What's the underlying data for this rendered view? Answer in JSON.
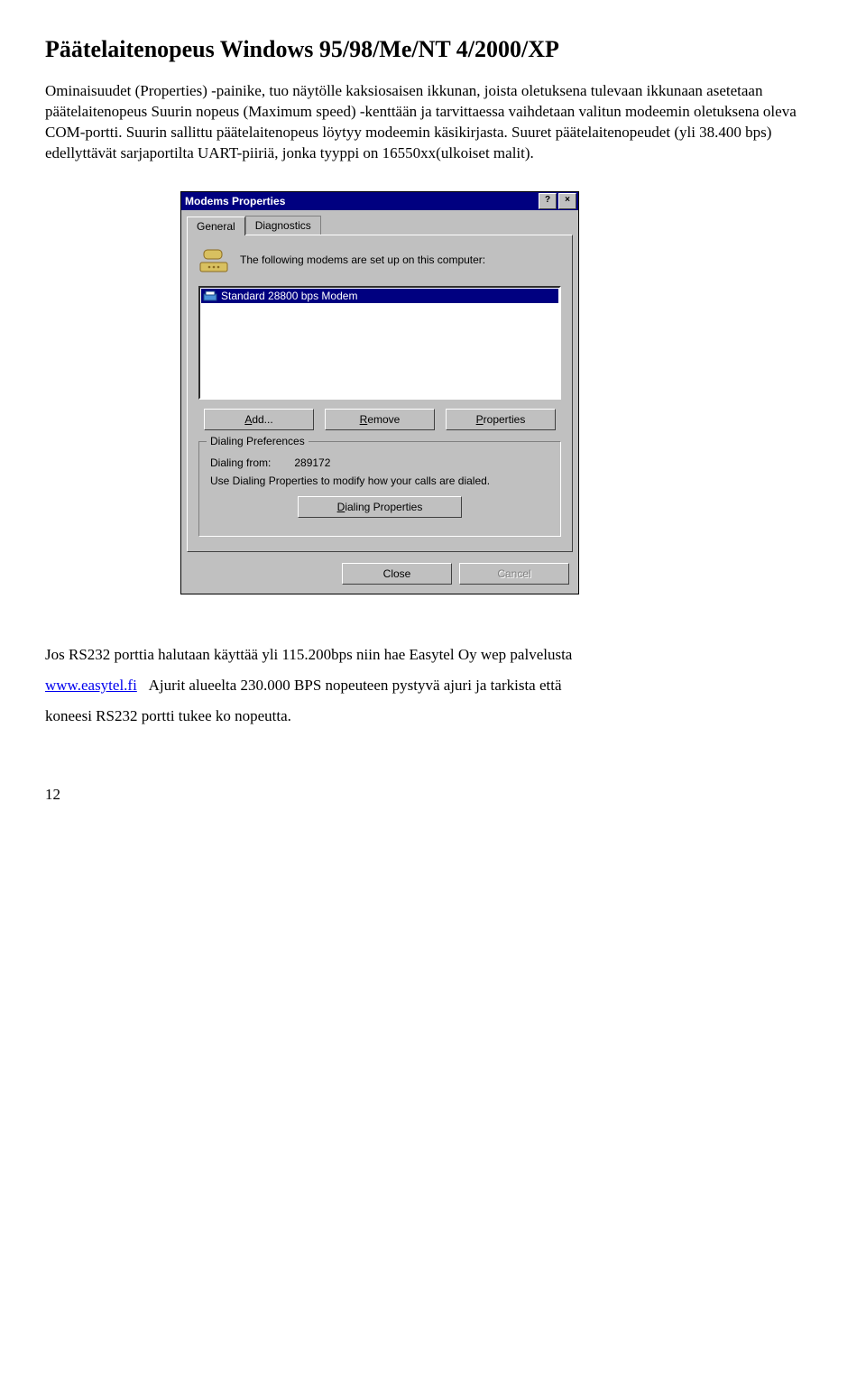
{
  "heading": "Päätelaitenopeus Windows 95/98/Me/NT 4/2000/XP",
  "para1": "Ominaisuudet (Properties) -painike, tuo näytölle kaksiosaisen ikkunan, joista oletuksena tulevaan ikkunaan asetetaan päätelaitenopeus Suurin nopeus (Maximum speed) -kenttään ja tarvittaessa vaihdetaan valitun modeemin oletuksena oleva COM-portti. Suurin sallittu päätelaitenopeus löytyy modeemin käsikirjasta. Suuret päätelaitenopeudet (yli 38.400 bps) edellyttävät sarjaportilta UART-piiriä, jonka tyyppi on 16550xx(ulkoiset malit).",
  "para2_prefix": "Jos RS232 porttia halutaan käyttää yli 115.200bps  niin hae Easytel Oy wep palvelusta",
  "link_text": "www.easytel.fi",
  "para2_suffix": "Ajurit alueelta  230.000 BPS nopeuteen pystyvä ajuri ja tarkista että",
  "para3": "koneesi RS232 portti tukee ko nopeutta.",
  "page_number": "12",
  "dialog": {
    "title": "Modems Properties",
    "help_btn": "?",
    "close_btn": "×",
    "tabs": {
      "general": "General",
      "diagnostics": "Diagnostics"
    },
    "info_text": "The following modems are set up on this computer:",
    "list_item": "Standard 28800 bps Modem",
    "buttons": {
      "add": "Add...",
      "add_accel": "A",
      "remove": "Remove",
      "remove_accel": "R",
      "properties": "Properties",
      "properties_accel": "P"
    },
    "group": {
      "label": "Dialing Preferences",
      "dialing_from_lbl": "Dialing from:",
      "dialing_from_val": "289172",
      "hint": "Use Dialing Properties to modify how your calls are dialed.",
      "dial_props_btn": "Dialing Properties",
      "dial_props_accel": "D"
    },
    "close": "Close",
    "cancel": "Cancel"
  }
}
